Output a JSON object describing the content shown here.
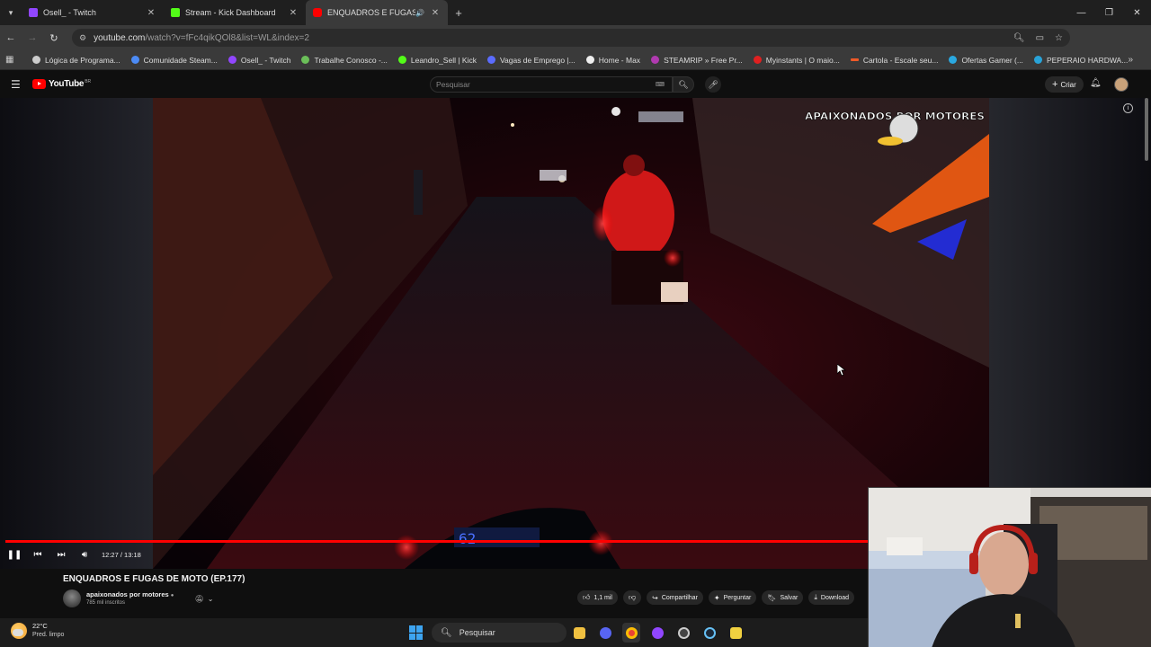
{
  "tabs": [
    {
      "title": "Osell_ - Twitch",
      "color": "#9146ff"
    },
    {
      "title": "Stream - Kick Dashboard",
      "color": "#53fc18"
    },
    {
      "title": "ENQUADROS E FUGAS DE M",
      "color": "#ff0000",
      "active": true
    }
  ],
  "address": {
    "url_host": "youtube.com",
    "url_path": "/watch?v=fFc4qikQOl8&list=WL&index=2"
  },
  "bookmarks": [
    {
      "label": "Lógica de Programa...",
      "color": "#cccccc"
    },
    {
      "label": "Comunidade Steam...",
      "color": "#4c8bf5"
    },
    {
      "label": "Osell_ - Twitch",
      "color": "#9146ff"
    },
    {
      "label": "Trabalhe Conosco -...",
      "color": "#6bbf59"
    },
    {
      "label": "Leandro_Sell | Kick",
      "color": "#53fc18"
    },
    {
      "label": "Vagas de Emprego |...",
      "color": "#5b6cff"
    },
    {
      "label": "Home - Max",
      "color": "#eeeeee"
    },
    {
      "label": "STEAMRIP » Free Pr...",
      "color": "#b03ab0"
    },
    {
      "label": "Myinstants | O maio...",
      "color": "#e02020"
    },
    {
      "label": "Cartola - Escale seu...",
      "color": "#f05a28"
    },
    {
      "label": "Ofertas Gamer (...",
      "color": "#2aa8e0"
    },
    {
      "label": "PEPERAIO HARDWA...",
      "color": "#29a3d8"
    }
  ],
  "youtube": {
    "logo_word": "YouTube",
    "region": "BR",
    "search_placeholder": "Pesquisar",
    "create_label": "Criar"
  },
  "player": {
    "current_time": "12:27",
    "duration": "13:18",
    "timecode": "12:27 / 13:18",
    "progress_fraction": 0.936
  },
  "video": {
    "title": "ENQUADROS E FUGAS DE MOTO (EP.177)",
    "channel": "apaixonados por motores",
    "subscribers": "785 mil inscritos",
    "likes": "1,1 mil",
    "share_label": "Compartilhar",
    "ask_label": "Perguntar",
    "save_label": "Salvar",
    "download_label": "Download",
    "watermark_text": "APAIXONADOS POR MOTORES",
    "dash_speed": "62"
  },
  "taskbar": {
    "temperature": "22°C",
    "condition": "Pred. limpo",
    "search_label": "Pesquisar"
  },
  "colors": {
    "accent_red": "#ff0000",
    "background": "#0f0f0f"
  }
}
